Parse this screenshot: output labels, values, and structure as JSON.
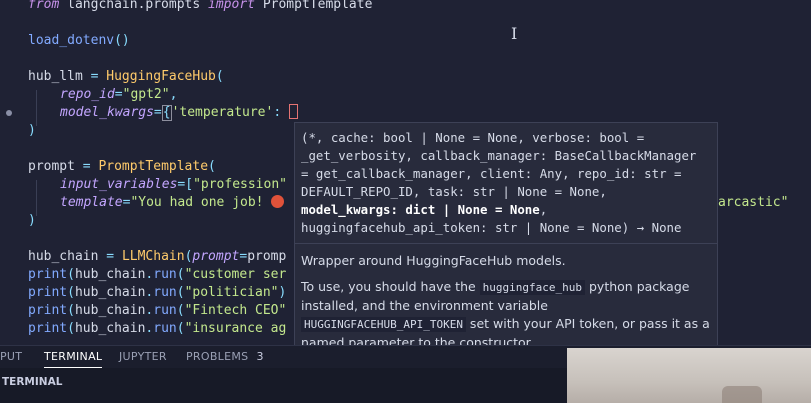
{
  "code": {
    "line1": {
      "kw": "from",
      "mod": " langchain.prompts ",
      "kw2": "import",
      "name": " PromptTemplate"
    },
    "line2": {
      "fn": "load_dotenv",
      "pun": "()"
    },
    "line3": {
      "var": "hub_llm",
      "op": " = ",
      "cls": "HuggingFaceHub",
      "pun": "("
    },
    "line4": {
      "prm": "repo_id",
      "op": "=",
      "str": "\"gpt2\"",
      "pun": ","
    },
    "line5": {
      "prm": "model_kwargs",
      "op": "=",
      "brace": "{",
      "str": "'temperature'",
      "colon": ": "
    },
    "line6": {
      "pun": ")"
    },
    "line7": {
      "var": "prompt",
      "op": " = ",
      "cls": "PromptTemplate",
      "pun": "("
    },
    "line8": {
      "prm": "input_variables",
      "op": "=",
      "pun": "[",
      "str": "\"profession\""
    },
    "line9": {
      "prm": "template",
      "op": "=",
      "str": "\"You had one job! ",
      "tail": "arcastic\""
    },
    "line10": {
      "pun": ")"
    },
    "line11": {
      "var": "hub_chain",
      "op": " = ",
      "cls": "LLMChain",
      "pun": "(",
      "prm": "prompt",
      "op2": "=",
      "var2": "promp"
    },
    "line12": {
      "fn": "print",
      "pun": "(",
      "var": "hub_chain",
      "dot": ".",
      "fn2": "run",
      "pun2": "(",
      "str": "\"customer ser"
    },
    "line13": {
      "fn": "print",
      "pun": "(",
      "var": "hub_chain",
      "dot": ".",
      "fn2": "run",
      "pun2": "(",
      "str": "\"politician\"",
      "pun3": ")"
    },
    "line14": {
      "fn": "print",
      "pun": "(",
      "var": "hub_chain",
      "dot": ".",
      "fn2": "run",
      "pun2": "(",
      "str": "\"Fintech CEO\""
    },
    "line15": {
      "fn": "print",
      "pun": "(",
      "var": "hub_chain",
      "dot": ".",
      "fn2": "run",
      "pun2": "(",
      "str": "\"insurance ag"
    }
  },
  "hover": {
    "sig_a": "(*, cache: bool | None = None, verbose: bool = _get_verbosity, callback_manager: BaseCallbackManager = get_callback_manager, client: Any, repo_id: str = DEFAULT_REPO_ID, task: str | None = None, ",
    "sig_bold": "model_kwargs: dict | None = None",
    "sig_b": ", huggingfacehub_api_token: str | None = None) → None",
    "doc1": "Wrapper around HuggingFaceHub models.",
    "doc2_a": "To use, you should have the ",
    "doc2_code": "huggingface_hub",
    "doc2_b": " python package installed, and the environment variable ",
    "doc2_code2": "HUGGINGFACEHUB_API_TOKEN",
    "doc2_c": " set with your API token, or pass it as a named parameter to the constructor."
  },
  "panel": {
    "tabs": [
      {
        "label": "PUT"
      },
      {
        "label": "TERMINAL"
      },
      {
        "label": "JUPYTER"
      },
      {
        "label": "PROBLEMS",
        "badge": "3"
      }
    ],
    "terminal_title": "TERMINAL"
  },
  "colors": {
    "editor_bg": "#1f2234",
    "keyword": "#c792ea",
    "class": "#ffcb6b",
    "string": "#c3e88d"
  }
}
